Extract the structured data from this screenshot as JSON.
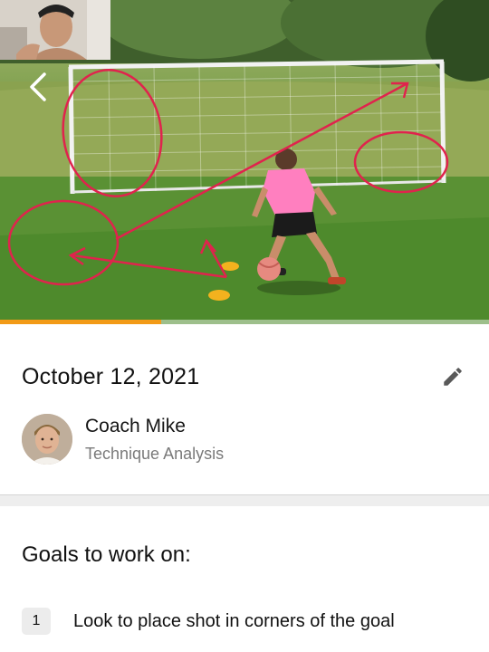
{
  "video": {
    "progress_fraction": 0.33,
    "annotation_color": "#e0234d",
    "progress_color": "#f29a17",
    "icons": {
      "back": "chevron-left-icon",
      "edit": "pencil-icon"
    }
  },
  "session": {
    "date": "October 12, 2021"
  },
  "coach": {
    "name": "Coach Mike",
    "role": "Technique Analysis"
  },
  "goals": {
    "title": "Goals to work on:",
    "items": [
      {
        "number": "1",
        "text": "Look to place shot in corners of the goal"
      }
    ]
  }
}
